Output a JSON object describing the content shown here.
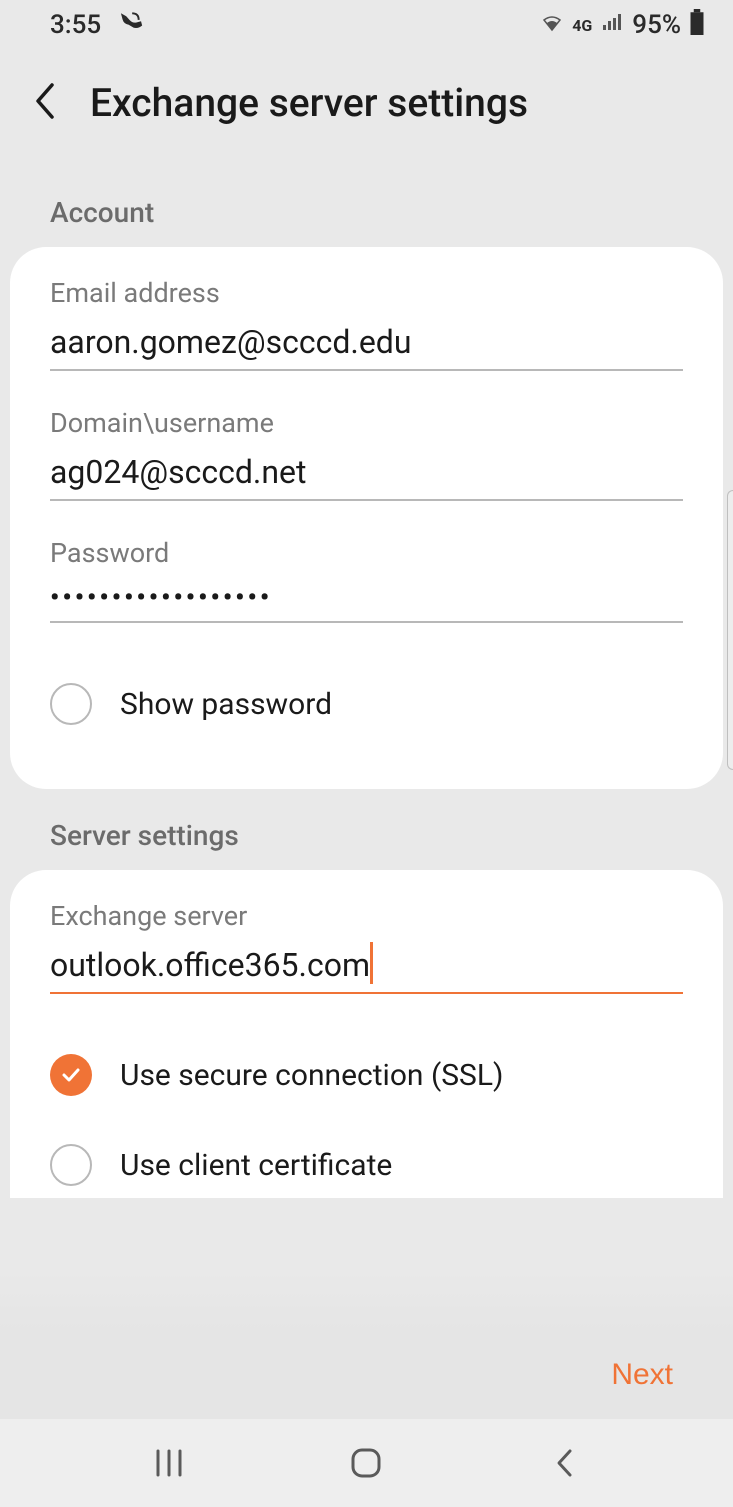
{
  "status": {
    "time": "3:55",
    "network": "4G",
    "battery": "95%"
  },
  "header": {
    "title": "Exchange server settings"
  },
  "account": {
    "section_label": "Account",
    "email_label": "Email address",
    "email_value": "aaron.gomez@scccd.edu",
    "domain_label": "Domain\\username",
    "domain_value": "ag024@scccd.net",
    "password_label": "Password",
    "password_value": "••••••••••••••••••",
    "show_password_label": "Show password"
  },
  "server": {
    "section_label": "Server settings",
    "exchange_label": "Exchange server",
    "exchange_value": "outlook.office365.com",
    "ssl_label": "Use secure connection (SSL)",
    "client_cert_label": "Use client certificate"
  },
  "actions": {
    "next": "Next"
  }
}
